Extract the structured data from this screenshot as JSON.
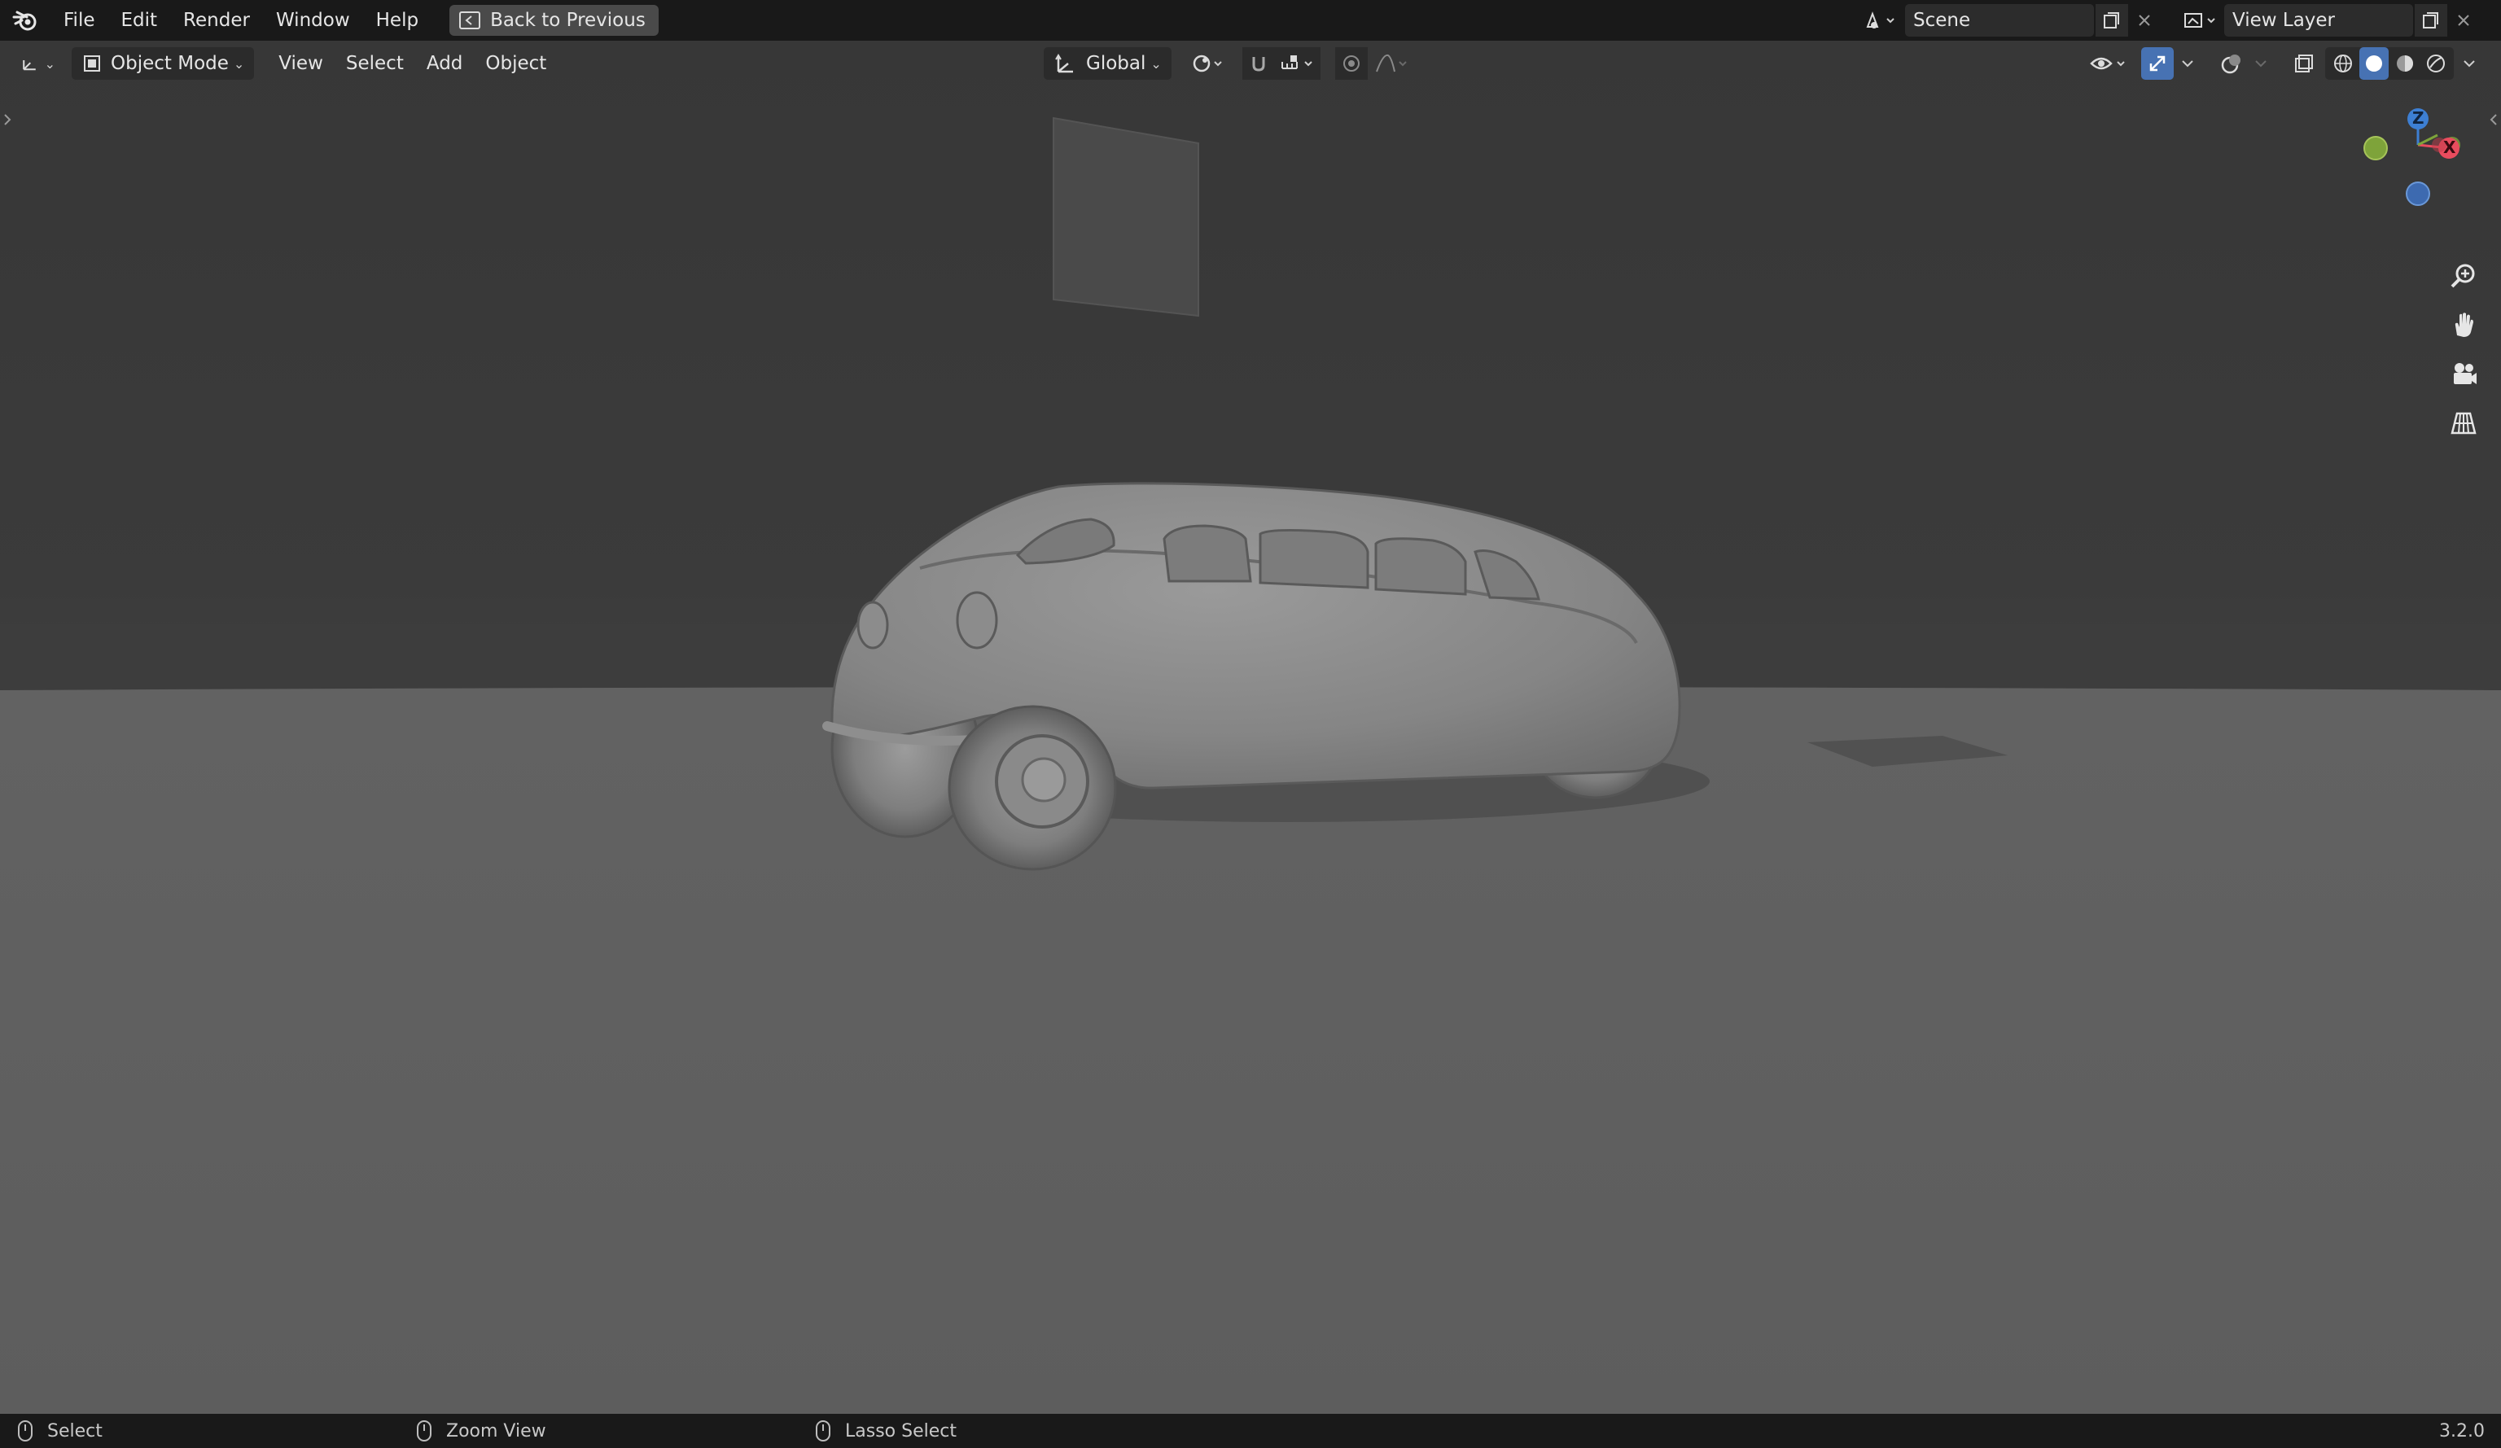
{
  "menu": {
    "items": [
      "File",
      "Edit",
      "Render",
      "Window",
      "Help"
    ],
    "back_button": "Back to Previous"
  },
  "scene": {
    "label": "Scene"
  },
  "view_layer": {
    "label": "View Layer"
  },
  "viewport_header": {
    "mode": "Object Mode",
    "menus": [
      "View",
      "Select",
      "Add",
      "Object"
    ],
    "transform_orientation": "Global"
  },
  "gizmo": {
    "z": "Z",
    "x": "X"
  },
  "status": {
    "select": "Select",
    "zoom": "Zoom View",
    "lasso": "Lasso Select",
    "version": "3.2.0"
  },
  "colors": {
    "accent_blue": "#4772b3",
    "axis_x": "#e94c5e",
    "axis_y": "#7ea33a",
    "axis_z": "#3d7fd3"
  }
}
